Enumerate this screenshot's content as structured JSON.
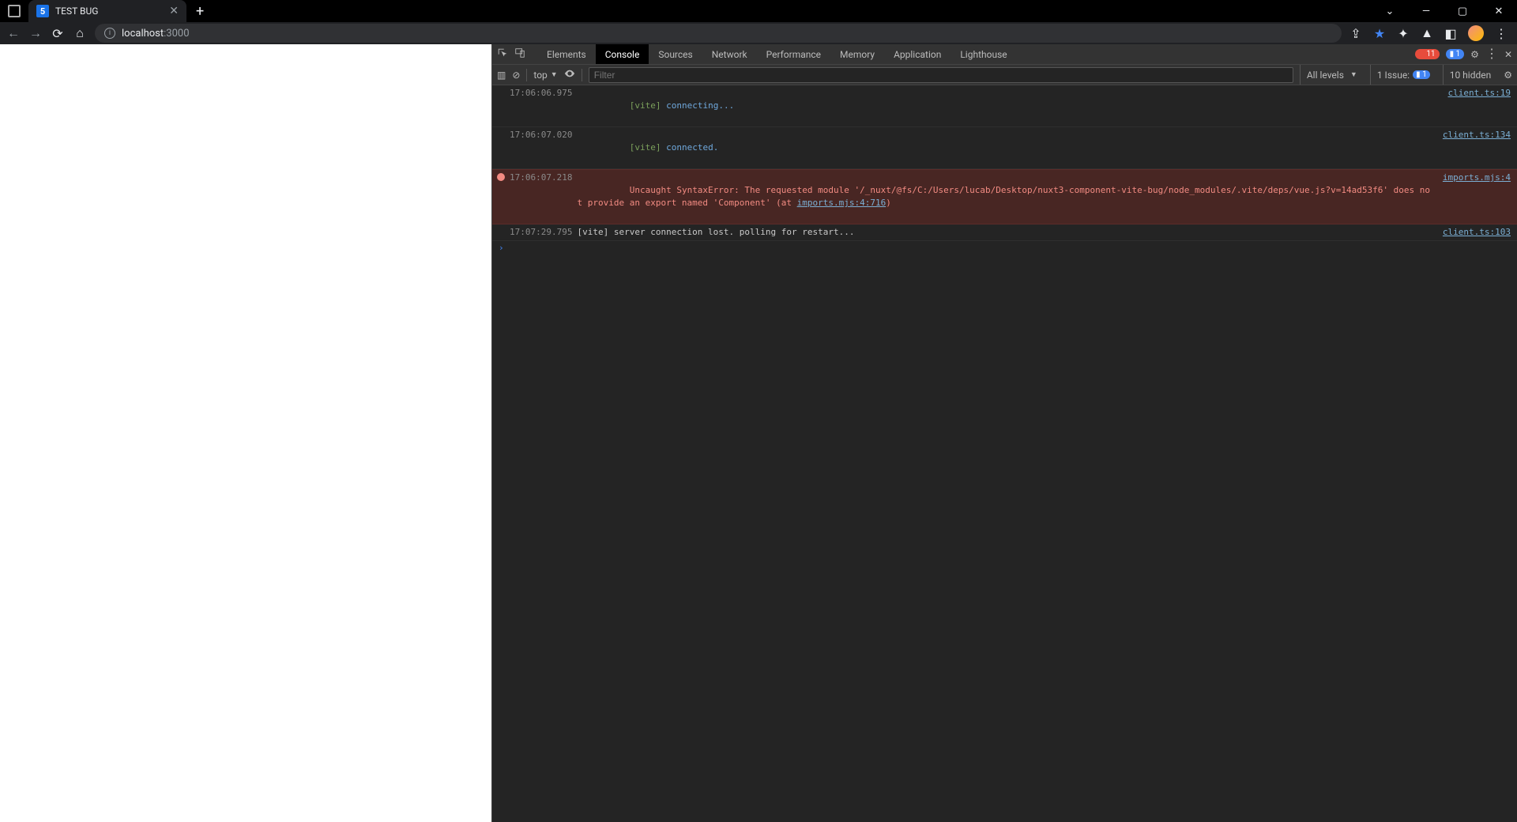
{
  "tab": {
    "title": "TEST BUG",
    "favicon_letter": "5"
  },
  "address": {
    "host": "localhost",
    "port": ":3000"
  },
  "devtools": {
    "tabs": [
      "Elements",
      "Console",
      "Sources",
      "Network",
      "Performance",
      "Memory",
      "Application",
      "Lighthouse"
    ],
    "active_tab": "Console",
    "errors_count": "11",
    "info_count": "1",
    "context_label": "top",
    "filter_placeholder": "Filter",
    "levels_label": "All levels",
    "issue_label": "1 Issue:",
    "issue_count": "1",
    "hidden_label": "10 hidden"
  },
  "logs": [
    {
      "ts": "17:06:06.975",
      "kind": "info",
      "vite_tag": "[vite]",
      "vite_msg": "connecting...",
      "src": "client.ts:19"
    },
    {
      "ts": "17:06:07.020",
      "kind": "info",
      "vite_tag": "[vite]",
      "vite_msg": "connected.",
      "src": "client.ts:134"
    },
    {
      "ts": "17:06:07.218",
      "kind": "error",
      "err_pre": "Uncaught SyntaxError: The requested module '/_nuxt/@fs/C:/Users/lucab/Desktop/nuxt3-component-vite-bug/node_modules/.vite/deps/vue.js?v=14ad53f6' does not provide an export named 'Component' (at ",
      "err_link": "imports.mjs:4:716",
      "err_post": ")",
      "src": "imports.mjs:4"
    },
    {
      "ts": "17:07:29.795",
      "kind": "plain",
      "plain_msg": "[vite] server connection lost. polling for restart...",
      "src": "client.ts:103"
    }
  ]
}
